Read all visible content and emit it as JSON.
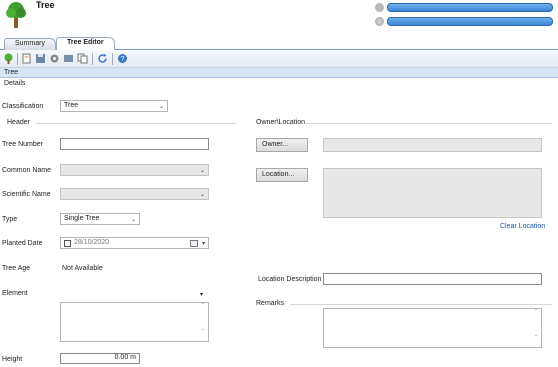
{
  "app": {
    "title": "Tree"
  },
  "tabs": [
    {
      "label": "Summary"
    },
    {
      "label": "Tree Editor"
    }
  ],
  "section": {
    "title": "Tree"
  },
  "form": {
    "details_label": "Details",
    "classification_label": "Classification",
    "classification_value": "Tree",
    "header_label": "Header",
    "tree_number_label": "Tree Number",
    "tree_number_value": "",
    "common_name_label": "Common Name",
    "common_name_value": "",
    "scientific_name_label": "Scientific Name",
    "scientific_name_value": "",
    "type_label": "Type",
    "type_value": "Single Tree",
    "planted_date_label": "Planted Date",
    "planted_date_value": "28/10/2020",
    "tree_age_label": "Tree Age",
    "tree_age_value": "Not Available",
    "element_label": "Element",
    "element_value": "",
    "height_label": "Height",
    "height_value": "0.00 m",
    "owner_location_label": "Owner\\Location",
    "owner_button": "Owner...",
    "owner_value": "",
    "location_button": "Location...",
    "location_value": "",
    "clear_location_link": "Clear Location",
    "location_description_label": "Location Description",
    "location_description_value": "",
    "remarks_label": "Remarks",
    "remarks_value": ""
  },
  "colors": {
    "accent": "#3b86d6",
    "section_bar": "#d7e6f6",
    "link": "#1a55b8"
  }
}
